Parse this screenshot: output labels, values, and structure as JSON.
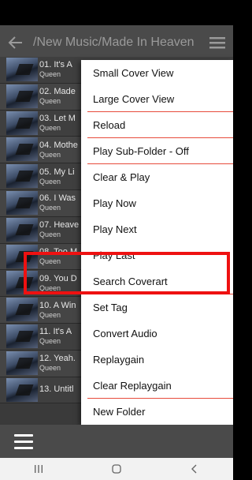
{
  "app_bar": {
    "title": "/New Music/Made In Heaven"
  },
  "tracks": [
    {
      "title": "01. It's A",
      "artist": "Queen"
    },
    {
      "title": "02. Made",
      "artist": "Queen"
    },
    {
      "title": "03. Let M",
      "artist": "Queen"
    },
    {
      "title": "04. Mothe",
      "artist": "Queen"
    },
    {
      "title": "05. My Li",
      "artist": "Queen"
    },
    {
      "title": "06. I Was",
      "artist": "Queen"
    },
    {
      "title": "07. Heave",
      "artist": "Queen"
    },
    {
      "title": "08. Too M",
      "artist": "Queen"
    },
    {
      "title": "09. You D",
      "artist": "Queen"
    },
    {
      "title": "10. A Win",
      "artist": "Queen"
    },
    {
      "title": "11. It's A",
      "artist": "Queen"
    },
    {
      "title": "12. Yeah.",
      "artist": "Queen"
    },
    {
      "title": "13. Untitl",
      "artist": ""
    }
  ],
  "menu": {
    "items": [
      "Small Cover View",
      "Large Cover View",
      "Reload",
      "Play Sub-Folder - Off",
      "Clear & Play",
      "Play Now",
      "Play Next",
      "Play Last",
      "Search Coverart",
      "Set Tag",
      "Convert Audio",
      "Replaygain",
      "Clear Replaygain",
      "New Folder"
    ]
  },
  "icons": {
    "back": "arrow-left-icon",
    "overflow": "hamburger-icon",
    "bottom_menu": "hamburger-icon",
    "nav_recents": "recents-icon",
    "nav_home": "home-icon",
    "nav_back": "back-chevron-icon"
  },
  "colors": {
    "highlight": "#ee1111",
    "separator": "#e74c3c",
    "app_bar": "#4a4a4a"
  }
}
